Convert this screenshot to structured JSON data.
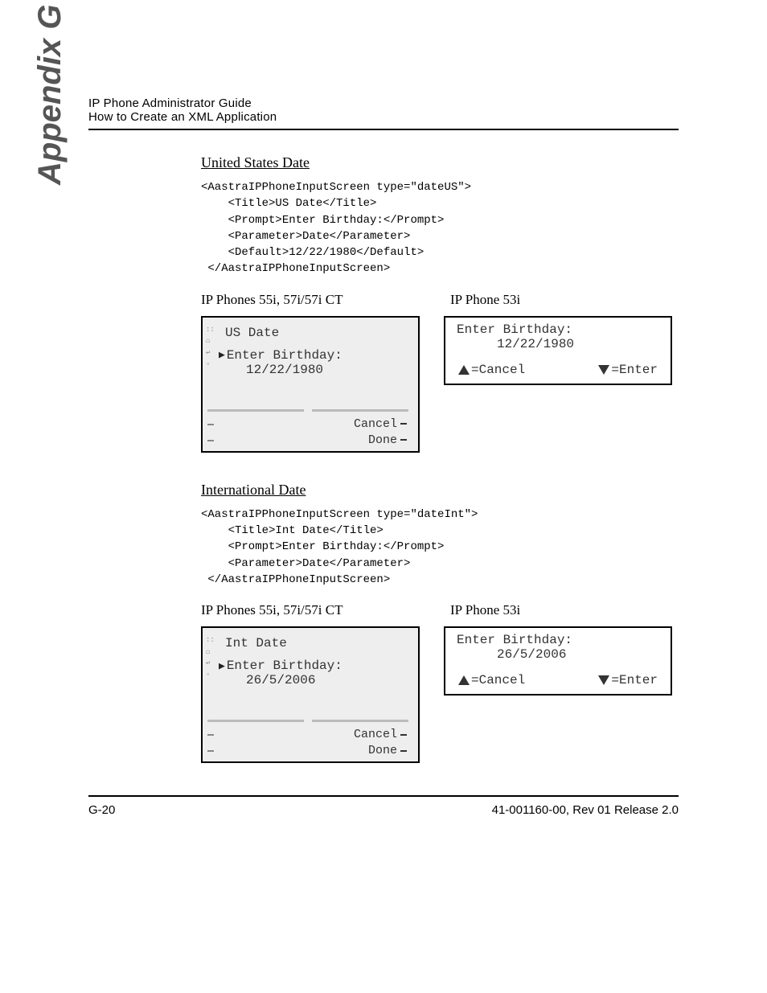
{
  "header": {
    "line1": "IP Phone Administrator Guide",
    "line2": "How to Create an XML Application"
  },
  "appendix": "Appendix G",
  "section1": {
    "heading": "United States Date",
    "code": "<AastraIPPhoneInputScreen type=\"dateUS\">\n    <Title>US Date</Title>\n    <Prompt>Enter Birthday:</Prompt>\n    <Parameter>Date</Parameter>\n    <Default>12/22/1980</Default>\n </AastraIPPhoneInputScreen>",
    "caption_left": "IP Phones 55i, 57i/57i CT",
    "caption_right": "IP Phone 53i",
    "large": {
      "title": "US Date",
      "prompt": "Enter Birthday:",
      "value": "12/22/1980",
      "soft1": "Cancel",
      "soft2": "Done"
    },
    "small": {
      "line1": "Enter Birthday:",
      "line2": "12/22/1980",
      "cancel": "=Cancel",
      "enter": "=Enter"
    }
  },
  "section2": {
    "heading": "International Date",
    "code": "<AastraIPPhoneInputScreen type=\"dateInt\">\n    <Title>Int Date</Title>\n    <Prompt>Enter Birthday:</Prompt>\n    <Parameter>Date</Parameter>\n </AastraIPPhoneInputScreen>",
    "caption_left": "IP Phones 55i, 57i/57i CT",
    "caption_right": "IP Phone 53i",
    "large": {
      "title": "Int Date",
      "prompt": "Enter Birthday:",
      "value": "26/5/2006",
      "soft1": "Cancel",
      "soft2": "Done"
    },
    "small": {
      "line1": "Enter Birthday:",
      "line2": "26/5/2006",
      "cancel": "=Cancel",
      "enter": "=Enter"
    }
  },
  "footer": {
    "left": "G-20",
    "right": "41-001160-00, Rev 01  Release 2.0"
  }
}
